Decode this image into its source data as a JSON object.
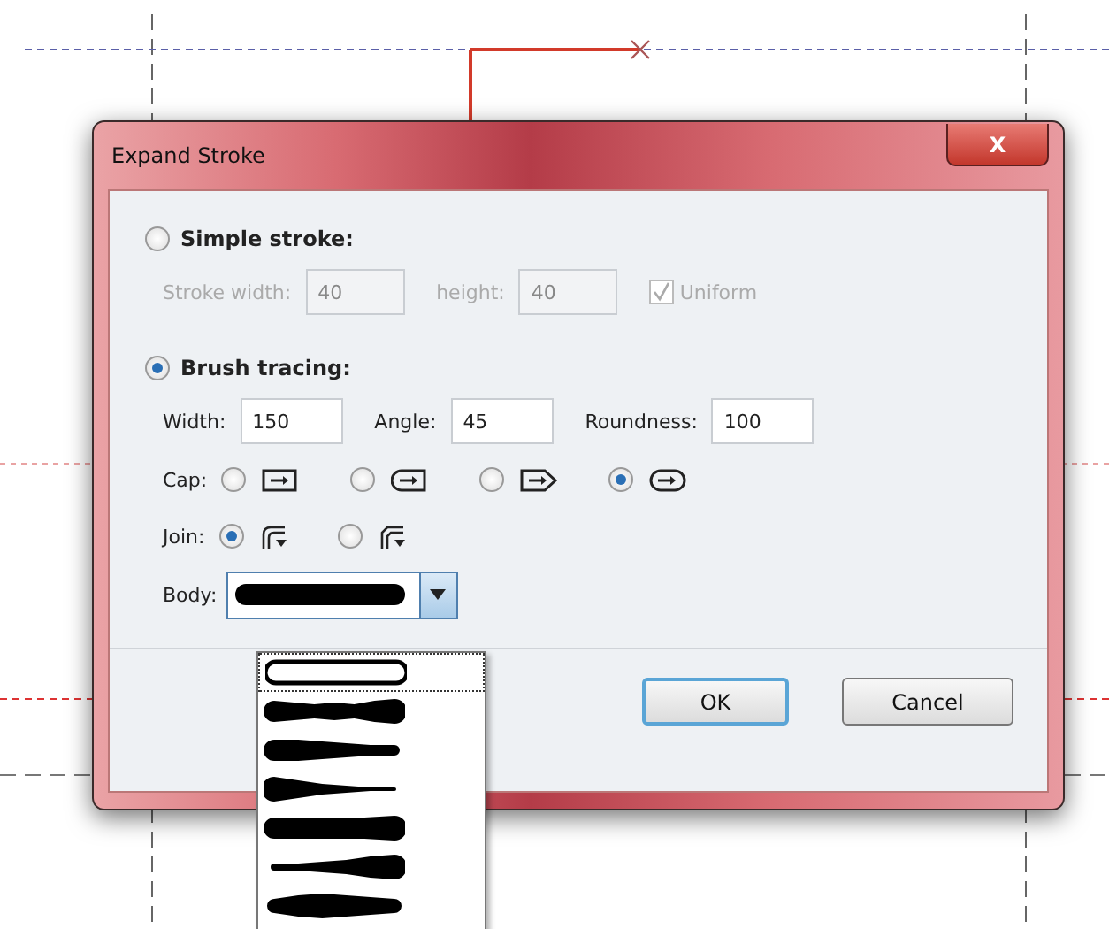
{
  "window": {
    "title": "Expand Stroke",
    "close": "X"
  },
  "simple_stroke": {
    "label": "Simple stroke:",
    "selected": false,
    "stroke_width": {
      "label": "Stroke width:",
      "value": "40",
      "disabled": true
    },
    "height": {
      "label": "height:",
      "value": "40",
      "disabled": true
    },
    "uniform": {
      "label": "Uniform",
      "checked": true,
      "disabled": true
    }
  },
  "brush_tracing": {
    "label": "Brush tracing:",
    "selected": true,
    "fields": [
      {
        "label": "Width:",
        "value": "150"
      },
      {
        "label": "Angle:",
        "value": "45"
      },
      {
        "label": "Roundness:",
        "value": "100"
      }
    ],
    "cap": {
      "label": "Cap:",
      "options": [
        {
          "kind": "butt",
          "selected": false
        },
        {
          "kind": "round-start",
          "selected": false
        },
        {
          "kind": "point-end",
          "selected": false
        },
        {
          "kind": "round",
          "selected": true
        }
      ]
    },
    "join": {
      "label": "Join:",
      "options": [
        {
          "kind": "miter",
          "selected": true
        },
        {
          "kind": "round",
          "selected": false
        }
      ]
    },
    "body": {
      "label": "Body:",
      "expanded": true,
      "options": [
        {
          "kind": "round",
          "selected": true
        },
        {
          "kind": "bumpy",
          "selected": false
        },
        {
          "kind": "taper",
          "selected": false
        },
        {
          "kind": "thin-taper",
          "selected": false
        },
        {
          "kind": "straight",
          "selected": false
        },
        {
          "kind": "swell-end",
          "selected": false
        },
        {
          "kind": "swell",
          "selected": false
        }
      ]
    }
  },
  "buttons": [
    {
      "label": "OK",
      "kind": "default"
    },
    {
      "label": "Cancel",
      "kind": "normal"
    }
  ]
}
